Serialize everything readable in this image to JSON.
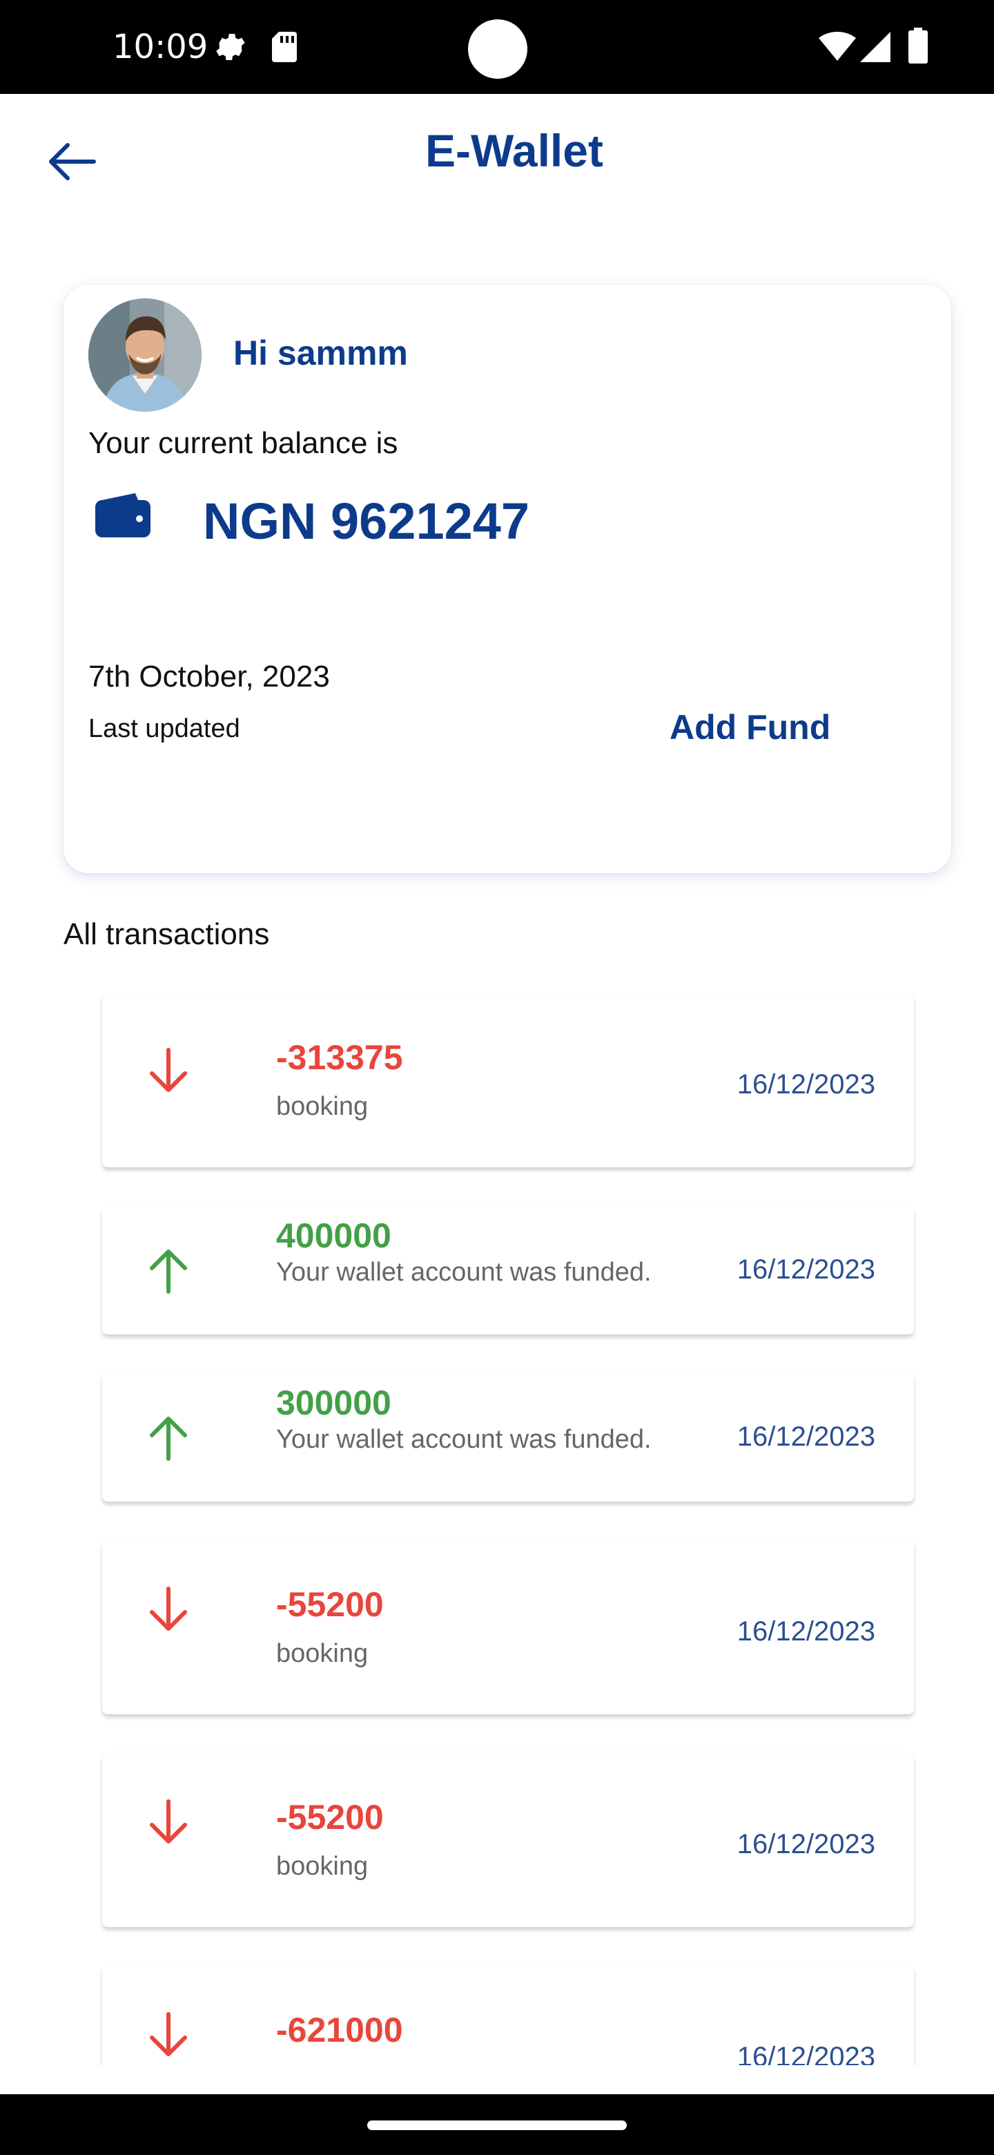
{
  "status_bar": {
    "time": "10:09",
    "icons": [
      "settings-icon",
      "sd-card-icon",
      "wifi-icon",
      "signal-icon",
      "battery-icon"
    ]
  },
  "app_bar": {
    "title": "E-Wallet",
    "back_icon": "arrow-left-icon"
  },
  "balance_card": {
    "greeting": "Hi sammm",
    "balance_label": "Your current balance is",
    "balance": "NGN 9621247",
    "date": "7th October, 2023",
    "last_updated_label": "Last updated",
    "add_fund_label": "Add Fund"
  },
  "transactions_title": "All transactions",
  "transactions": [
    {
      "amount": "-313375",
      "description": "booking",
      "date": "16/12/2023",
      "direction": "debit"
    },
    {
      "amount": "400000",
      "description": "Your wallet account was funded.",
      "date": "16/12/2023",
      "direction": "credit"
    },
    {
      "amount": "300000",
      "description": "Your wallet account was funded.",
      "date": "16/12/2023",
      "direction": "credit"
    },
    {
      "amount": "-55200",
      "description": "booking",
      "date": "16/12/2023",
      "direction": "debit"
    },
    {
      "amount": "-55200",
      "description": "booking",
      "date": "16/12/2023",
      "direction": "debit"
    },
    {
      "amount": "-621000",
      "description": "",
      "date": "16/12/2023",
      "direction": "debit"
    }
  ],
  "colors": {
    "primary": "#0d3b8c",
    "debit": "#e8453c",
    "credit": "#43a047"
  }
}
